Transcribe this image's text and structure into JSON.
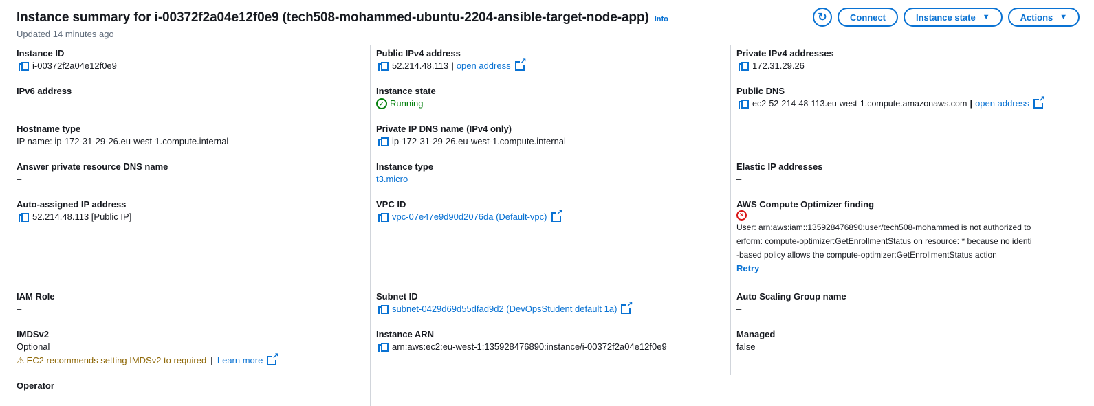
{
  "header": {
    "title": "Instance summary for i-00372f2a04e12f0e9 (tech508-mohammed-ubuntu-2204-ansible-target-node-app)",
    "info": "Info",
    "updated": "Updated 14 minutes ago"
  },
  "toolbar": {
    "connect": "Connect",
    "instance_state": "Instance state",
    "actions": "Actions"
  },
  "col1": {
    "instance_id_label": "Instance ID",
    "instance_id": "i-00372f2a04e12f0e9",
    "ipv6_label": "IPv6 address",
    "ipv6": "–",
    "hostname_type_label": "Hostname type",
    "hostname_type": "IP name: ip-172-31-29-26.eu-west-1.compute.internal",
    "answer_dns_label": "Answer private resource DNS name",
    "answer_dns": "–",
    "auto_ip_label": "Auto-assigned IP address",
    "auto_ip": "52.214.48.113 [Public IP]",
    "iam_role_label": "IAM Role",
    "iam_role": "–",
    "imdsv2_label": "IMDSv2",
    "imdsv2": "Optional",
    "imdsv2_warning": "EC2 recommends setting IMDSv2 to required",
    "learn_more": "Learn more",
    "operator_label": "Operator"
  },
  "col2": {
    "public_ipv4_label": "Public IPv4 address",
    "public_ipv4": "52.214.48.113",
    "open_address": "open address",
    "state_label": "Instance state",
    "state": "Running",
    "private_dns_label": "Private IP DNS name (IPv4 only)",
    "private_dns": "ip-172-31-29-26.eu-west-1.compute.internal",
    "type_label": "Instance type",
    "type": "t3.micro",
    "vpc_label": "VPC ID",
    "vpc": "vpc-07e47e9d90d2076da (Default-vpc)",
    "subnet_label": "Subnet ID",
    "subnet": "subnet-0429d69d55dfad9d2 (DevOpsStudent default 1a)",
    "arn_label": "Instance ARN",
    "arn": "arn:aws:ec2:eu-west-1:135928476890:instance/i-00372f2a04e12f0e9"
  },
  "col3": {
    "private_ipv4_label": "Private IPv4 addresses",
    "private_ipv4": "172.31.29.26",
    "public_dns_label": "Public DNS",
    "public_dns": "ec2-52-214-48-113.eu-west-1.compute.amazonaws.com",
    "open_address": "open address",
    "elastic_ip_label": "Elastic IP addresses",
    "elastic_ip": "–",
    "optimizer_label": "AWS Compute Optimizer finding",
    "optimizer_line1": "User: arn:aws:iam::135928476890:user/tech508-mohammed is not authorized to",
    "optimizer_line2": "erform: compute-optimizer:GetEnrollmentStatus on resource: * because no identi",
    "optimizer_line3": "-based policy allows the compute-optimizer:GetEnrollmentStatus action",
    "retry": "Retry",
    "asg_label": "Auto Scaling Group name",
    "asg": "–",
    "managed_label": "Managed",
    "managed": "false"
  }
}
